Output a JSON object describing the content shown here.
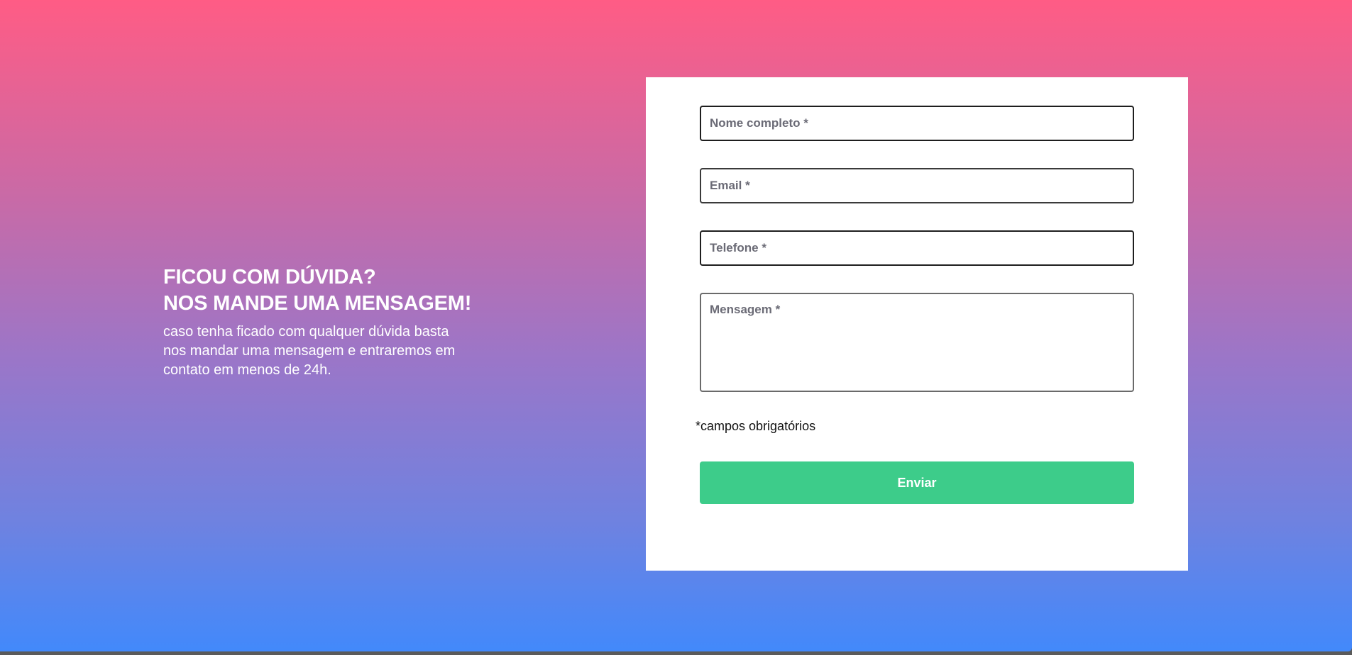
{
  "contact": {
    "headline_line1": "FICOU COM DÚVIDA?",
    "headline_line2": "NOS MANDE UMA MENSAGEM!",
    "subtext": "caso tenha ficado com qualquer dúvida basta nos mandar uma mensagem e entraremos em contato em menos de 24h."
  },
  "form": {
    "name_placeholder": "Nome completo *",
    "email_placeholder": "Email *",
    "phone_placeholder": "Telefone *",
    "message_placeholder": "Mensagem *",
    "required_note": "*campos obrigatórios",
    "submit_label": "Enviar"
  },
  "colors": {
    "gradient_top": "#ff5c85",
    "gradient_bottom": "#4289fb",
    "submit_button": "#3dcc8a"
  }
}
